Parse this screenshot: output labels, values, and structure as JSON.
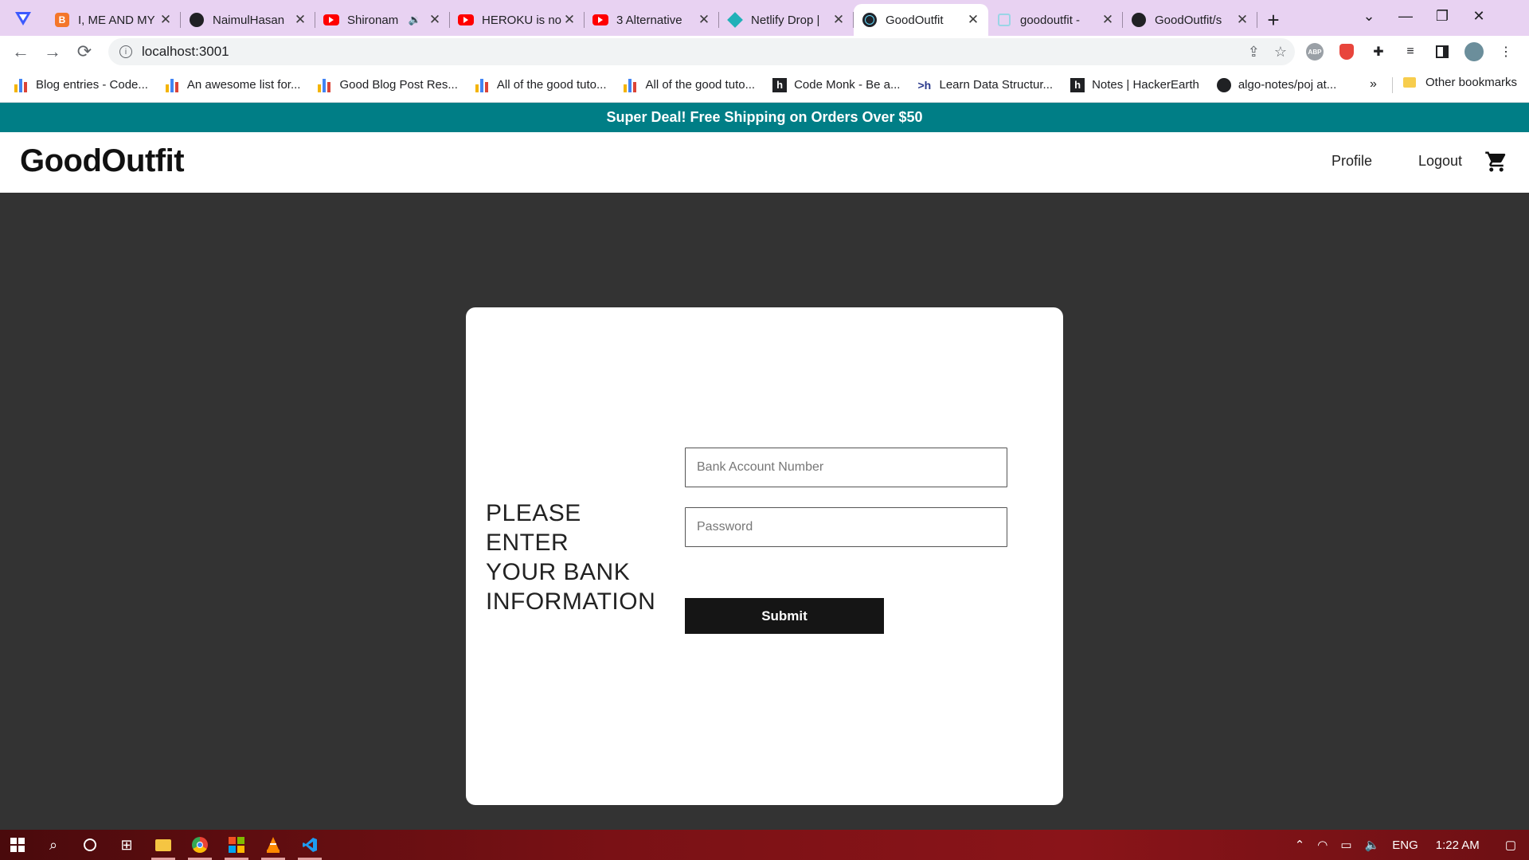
{
  "browser": {
    "tabs": [
      {
        "title": "I, ME AND MY",
        "icon": "blogger-icon",
        "color": "#f4762a"
      },
      {
        "title": "NaimulHasan",
        "icon": "github-icon",
        "color": "#202124"
      },
      {
        "title": "Shironam",
        "icon": "youtube-icon",
        "color": "#ff0000",
        "audio": true
      },
      {
        "title": "HEROKU is no",
        "icon": "youtube-icon",
        "color": "#ff0000"
      },
      {
        "title": "3 Alternative",
        "icon": "youtube-icon",
        "color": "#ff0000"
      },
      {
        "title": "Netlify Drop |",
        "icon": "netlify-icon",
        "color": "#20b1b8"
      },
      {
        "title": "GoodOutfit",
        "icon": "react-icon",
        "color": "#202124",
        "active": true
      },
      {
        "title": "goodoutfit -",
        "icon": "loading-icon",
        "color": "#9ad5e6"
      },
      {
        "title": "GoodOutfit/s",
        "icon": "github-icon",
        "color": "#202124"
      }
    ],
    "url": "localhost:3001",
    "bookmarks": [
      {
        "label": "Blog entries - Code...",
        "icon": "bars"
      },
      {
        "label": "An awesome list for...",
        "icon": "bars"
      },
      {
        "label": "Good Blog Post Res...",
        "icon": "bars"
      },
      {
        "label": "All of the good tuto...",
        "icon": "bars"
      },
      {
        "label": "All of the good tuto...",
        "icon": "bars"
      },
      {
        "label": "Code Monk - Be a...",
        "icon": "h"
      },
      {
        "label": "Learn Data Structur...",
        "icon": "gt"
      },
      {
        "label": "Notes | HackerEarth",
        "icon": "h"
      },
      {
        "label": "algo-notes/poj at...",
        "icon": "github"
      }
    ],
    "bookmarks_more": "»",
    "other_bookmarks": "Other bookmarks"
  },
  "page": {
    "promo_text": "Super Deal! Free Shipping on Orders Over $50",
    "logo": "GoodOutfit",
    "nav": {
      "profile": "Profile",
      "logout": "Logout"
    },
    "form": {
      "heading": "PLEASE ENTER YOUR BANK INFORMATION",
      "account_placeholder": "Bank Account Number",
      "password_placeholder": "Password",
      "submit_label": "Submit"
    }
  },
  "taskbar": {
    "language": "ENG",
    "time": "1:22 AM"
  },
  "colors": {
    "promo_bg": "#007e86",
    "page_bg": "#333333",
    "submit_bg": "#151515"
  }
}
